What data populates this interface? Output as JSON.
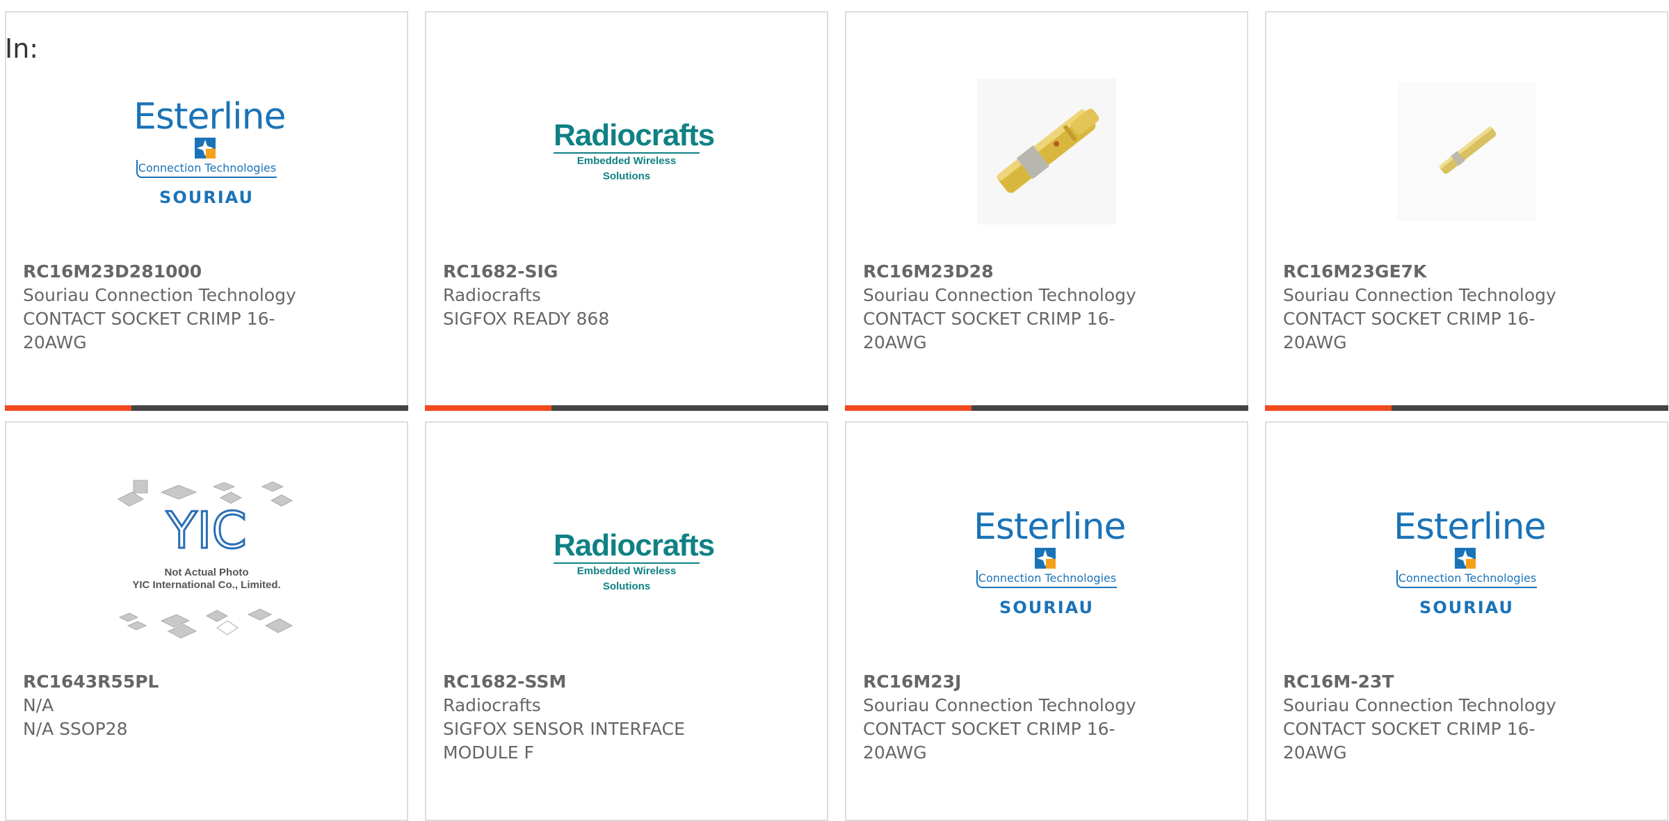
{
  "heading": {
    "label": "In:"
  },
  "brand_colors": {
    "accent": "#f04a1d",
    "bar": "#444444",
    "esterline_blue": "#1b73b7",
    "radiocrafts_teal": "#0f8184"
  },
  "products": [
    {
      "part_number": "RC16M23D281000",
      "manufacturer": "Souriau Connection Technology",
      "description": "CONTACT SOCKET CRIMP 16-20AWG",
      "image": "esterline-souriau-logo"
    },
    {
      "part_number": "RC1682-SIG",
      "manufacturer": "Radiocrafts",
      "description": "SIGFOX READY 868",
      "image": "radiocrafts-logo"
    },
    {
      "part_number": "RC16M23D28",
      "manufacturer": "Souriau Connection Technology",
      "description": "CONTACT SOCKET CRIMP 16-20AWG",
      "image": "gold-contact-large"
    },
    {
      "part_number": "RC16M23GE7K",
      "manufacturer": "Souriau Connection Technology",
      "description": "CONTACT SOCKET CRIMP 16-20AWG",
      "image": "gold-contact-small"
    },
    {
      "part_number": "RC1643R55PL",
      "manufacturer": "N/A",
      "description": "N/A SSOP28",
      "image": "yic-not-actual-photo"
    },
    {
      "part_number": "RC1682-SSM",
      "manufacturer": "Radiocrafts",
      "description": "SIGFOX SENSOR INTERFACE MODULE F",
      "image": "radiocrafts-logo"
    },
    {
      "part_number": "RC16M23J",
      "manufacturer": "Souriau Connection Technology",
      "description": "CONTACT SOCKET CRIMP 16-20AWG",
      "image": "esterline-souriau-logo"
    },
    {
      "part_number": "RC16M-23T",
      "manufacturer": "Souriau Connection Technology",
      "description": "CONTACT SOCKET CRIMP 16-20AWG",
      "image": "esterline-souriau-logo"
    }
  ],
  "logos": {
    "esterline": {
      "name": "Esterline",
      "tagline": "Connection Technologies",
      "brand": "SOURIAU"
    },
    "radiocrafts": {
      "name": "Radiocrafts",
      "tagline": "Embedded Wireless Solutions"
    },
    "yic": {
      "mark": "YIC",
      "line1": "Not Actual Photo",
      "line2": "YIC International Co., Limited."
    }
  }
}
